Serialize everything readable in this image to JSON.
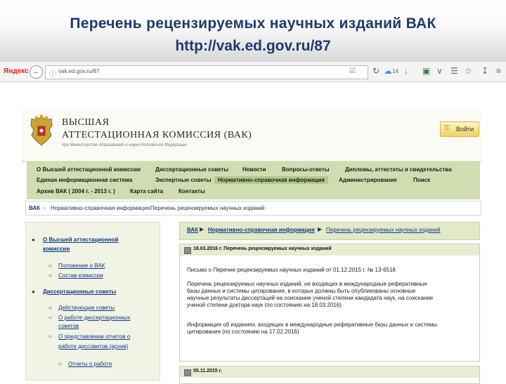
{
  "slide": {
    "title": "Перечень рецензируемых научных изданий ВАК",
    "url": "http://vak.ed.gov.ru/87"
  },
  "browser": {
    "brand": "Яндекс",
    "address": "vak.ed.gov.ru/87",
    "weather_temp": "14"
  },
  "site": {
    "org_line1": "ВЫСШАЯ",
    "org_line2": "АТТЕСТАЦИОННАЯ КОМИССИЯ (ВАК)",
    "org_line3": "при Министерстве образования и науки Российской Федерации",
    "login_label": "Войти",
    "nav_row1": [
      "О Высшей аттестационной комиссии",
      "Диссертационные советы",
      "Новости",
      "Вопросы-ответы",
      "Дипломы, аттестаты и свидетельства"
    ],
    "nav_row2": [
      "Единая информационная система",
      "Экспертные советы",
      "Нормативно-справочная информация",
      "Администрирование",
      "Поиск"
    ],
    "nav_row3": [
      "Архив ВАК ( 2004 г. - 2013 г. )",
      "Карта сайта",
      "Контакты"
    ],
    "breadcrumb": [
      "ВАК",
      "Нормативно-справочная информация",
      "Перечень рецензируемых научных изданий"
    ]
  },
  "sidebar": {
    "sec1_line1": "О Высшей аттестационной",
    "sec1_line2": "комиссии",
    "sec1_items": [
      "Положение о ВАК",
      "Состав комиссии"
    ],
    "sec2": "Диссертационные советы",
    "sec2_i1": "Действующие советы",
    "sec2_i2_l1": "О работе диссертационных",
    "sec2_i2_l2": "советов",
    "sec2_i3_l1": "О представлении отчетов о",
    "sec2_i3_l2": "работе диссоветов (архив)",
    "sec2_i4": "Отчеты о работе"
  },
  "content": {
    "crumb_a": "ВАК",
    "crumb_b": "Нормативно-справочная информация",
    "crumb_c": "Перечень рецензируемых научных изданий",
    "news1_date": "18.03.2016 г. Перечень рецензируемых научных изданий",
    "news1_p1": "Письмо о Перечне рецензируемых научных изданий от 01.12.2015 г. № 13-6518",
    "news1_p2_l1": "Перечень рецензируемых научных изданий, не входящих в международные реферативные",
    "news1_p2_l2": "базы данных и системы цитирования, в которых должны быть опубликованы основные",
    "news1_p2_l3": "научные результаты диссертаций на соискание ученой степени кандидата наук, на соискание",
    "news1_p2_l4": "ученой степени доктора наук (по состоянию на 18.03.2016)",
    "news1_p3_l1": "Информация об изданиях, входящих в международные реферативные базы данных и системы",
    "news1_p3_l2": "цитирования (по состоянию на 17.02.2016)",
    "news2_date": "05.11.2015 г."
  }
}
